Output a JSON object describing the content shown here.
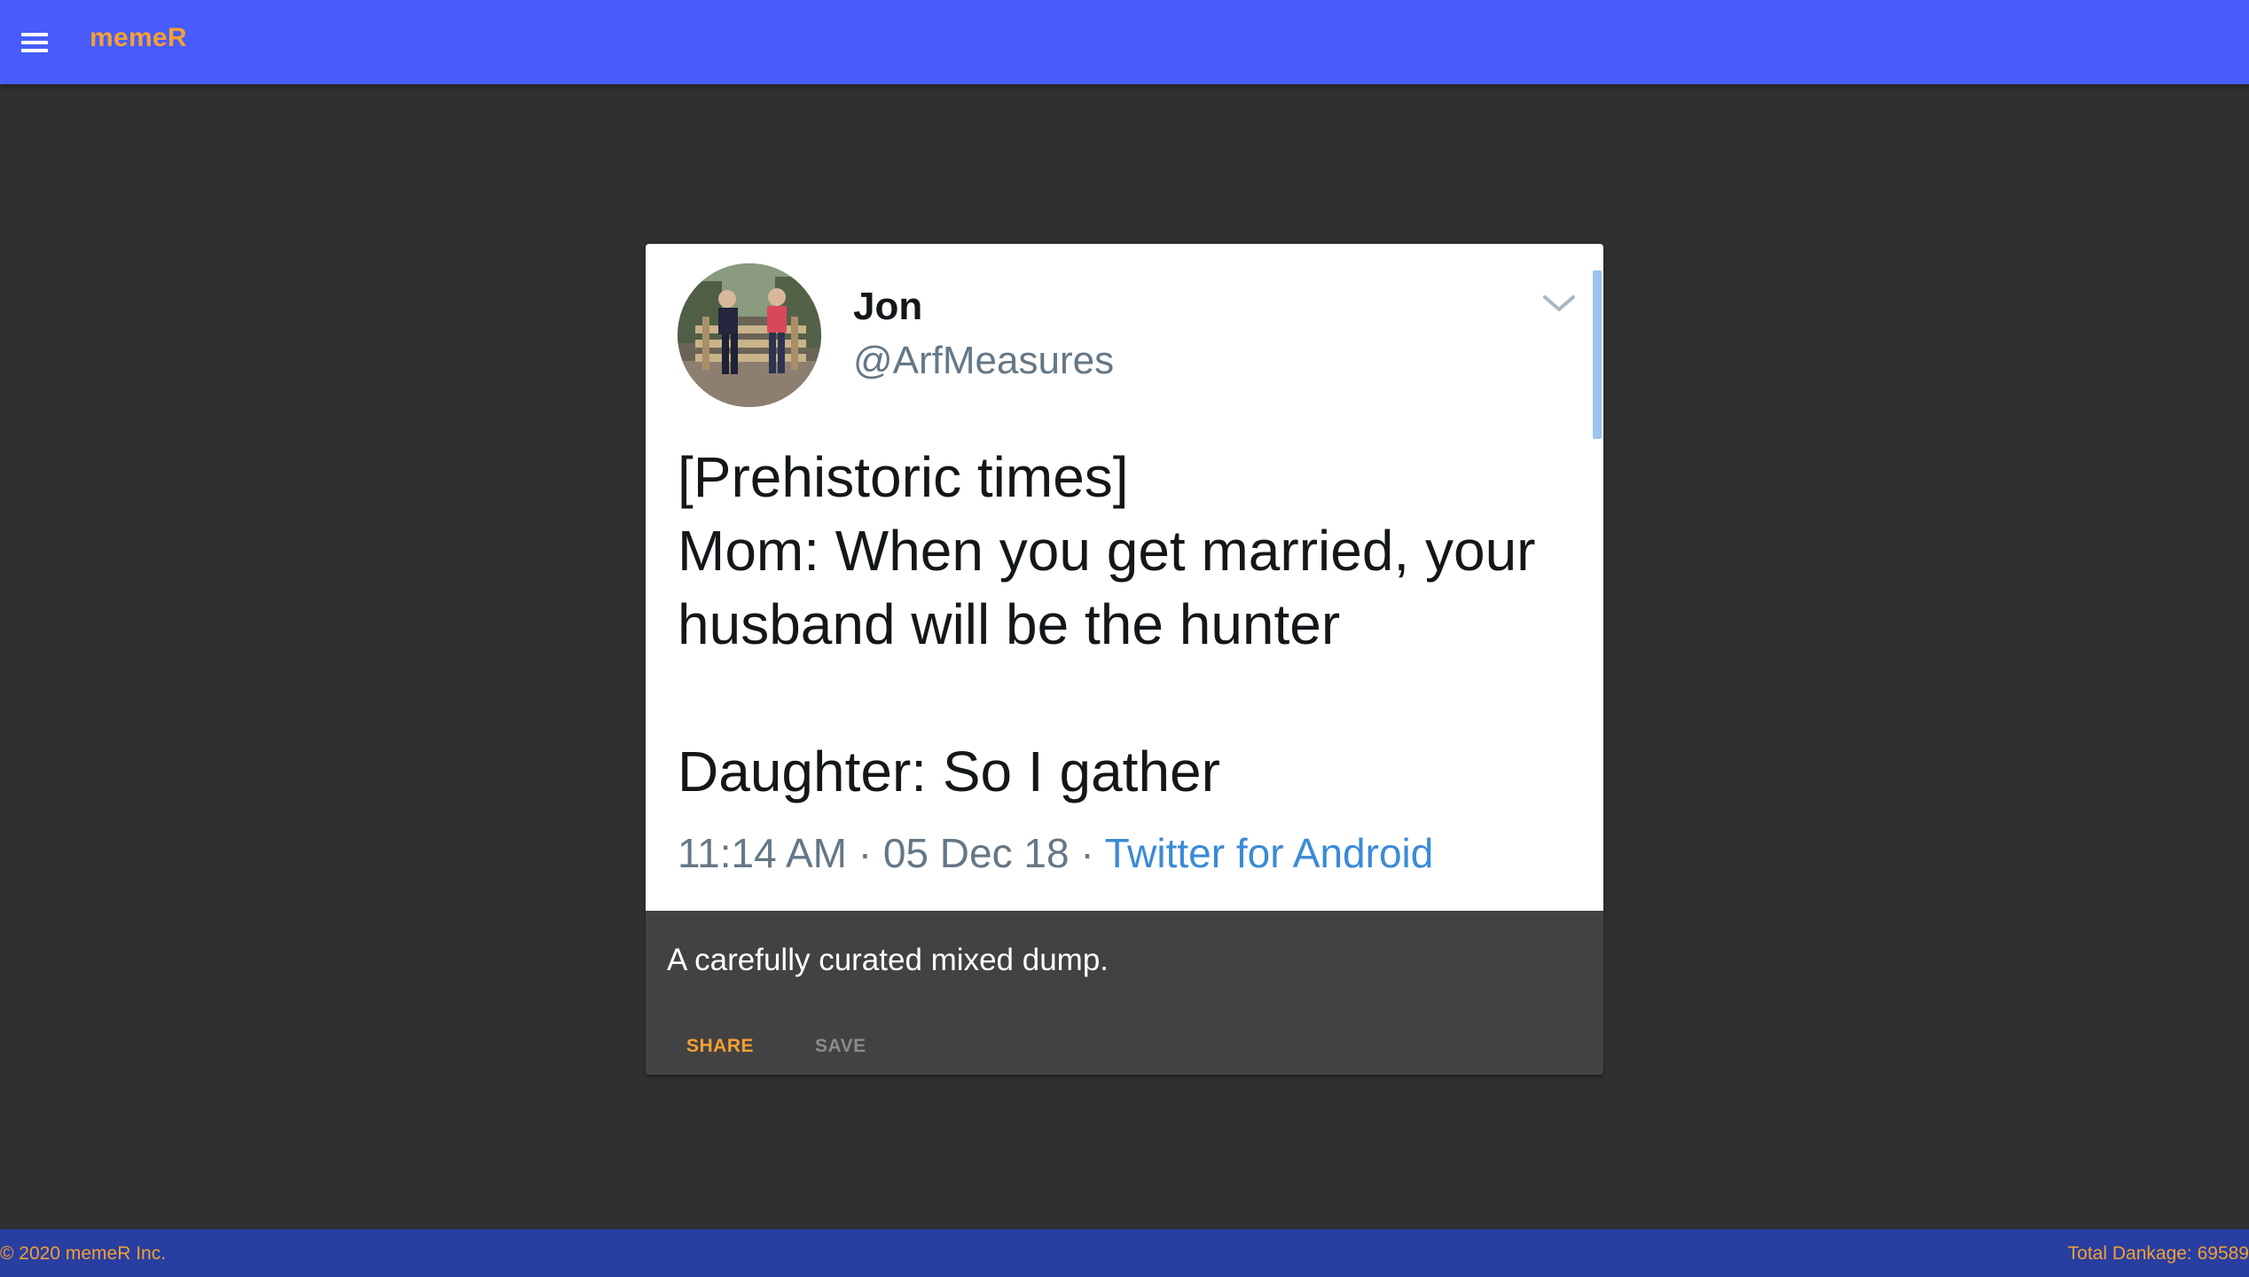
{
  "app": {
    "title": "memeR",
    "menu_icon": "hamburger-menu-icon"
  },
  "colors": {
    "appbar": "#475cfb",
    "accent": "#f5a033",
    "background": "#303030",
    "card": "#424242",
    "footer": "#283ea0",
    "tweet_link": "#3b8ad8"
  },
  "post": {
    "tweet": {
      "name": "Jon",
      "handle": "@ArfMeasures",
      "lines": [
        "[Prehistoric times]",
        "Mom: When you get married, your",
        "husband will be the hunter",
        "",
        "Daughter: So I gather"
      ],
      "time": "11:14 AM",
      "date": "05 Dec 18",
      "separator": " · ",
      "source": "Twitter for Android"
    },
    "caption": "A carefully curated mixed dump.",
    "actions": {
      "share": "SHARE",
      "save": "SAVE"
    }
  },
  "footer": {
    "copyright": "© 2020 memeR Inc.",
    "dankage": "Total Dankage: 69589"
  }
}
